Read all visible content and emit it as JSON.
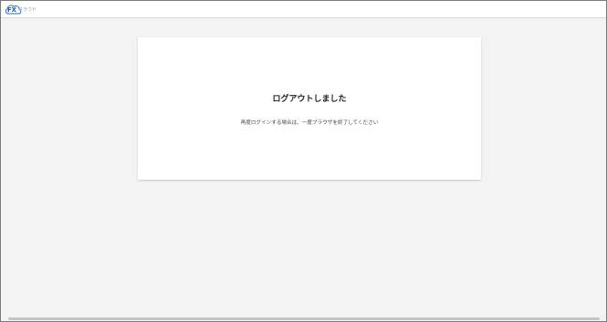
{
  "header": {
    "logo": {
      "mark": "FX",
      "text": "クラウド",
      "icon": "cloud-logo-icon",
      "color": "#1d5fa8"
    }
  },
  "main": {
    "title": "ログアウトしました",
    "message": "再度ログインする場合は、一度ブラウザを終了してください"
  }
}
